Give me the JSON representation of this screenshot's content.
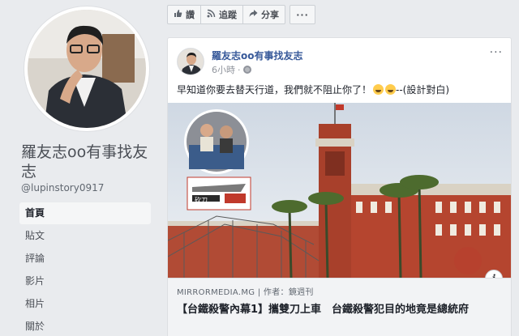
{
  "page": {
    "name": "羅友志oo有事找友志",
    "username": "@lupinstory0917"
  },
  "nav": {
    "items": [
      {
        "label": "首頁",
        "active": true
      },
      {
        "label": "貼文",
        "active": false
      },
      {
        "label": "評論",
        "active": false
      },
      {
        "label": "影片",
        "active": false
      },
      {
        "label": "相片",
        "active": false
      },
      {
        "label": "關於",
        "active": false
      }
    ]
  },
  "actions": {
    "like": "讚",
    "follow": "追蹤",
    "share": "分享",
    "more": "···"
  },
  "post": {
    "author": "羅友志oo有事找友志",
    "time": "6小時",
    "message": "早知道你要去替天行道，我們就不阻止你了！",
    "message_suffix": "--(設計對白)",
    "options": "···",
    "inset_label": "砍刀",
    "info": "i",
    "link": {
      "domain": "MIRRORMEDIA.MG | 作者：鏡週刊",
      "title": "【台鐵殺警內幕1】攜雙刀上車　台鐵殺警犯目的地竟是總統府"
    }
  },
  "colors": {
    "link_blue": "#365899",
    "background": "#e9ebee",
    "building_red": "#b5452f"
  }
}
